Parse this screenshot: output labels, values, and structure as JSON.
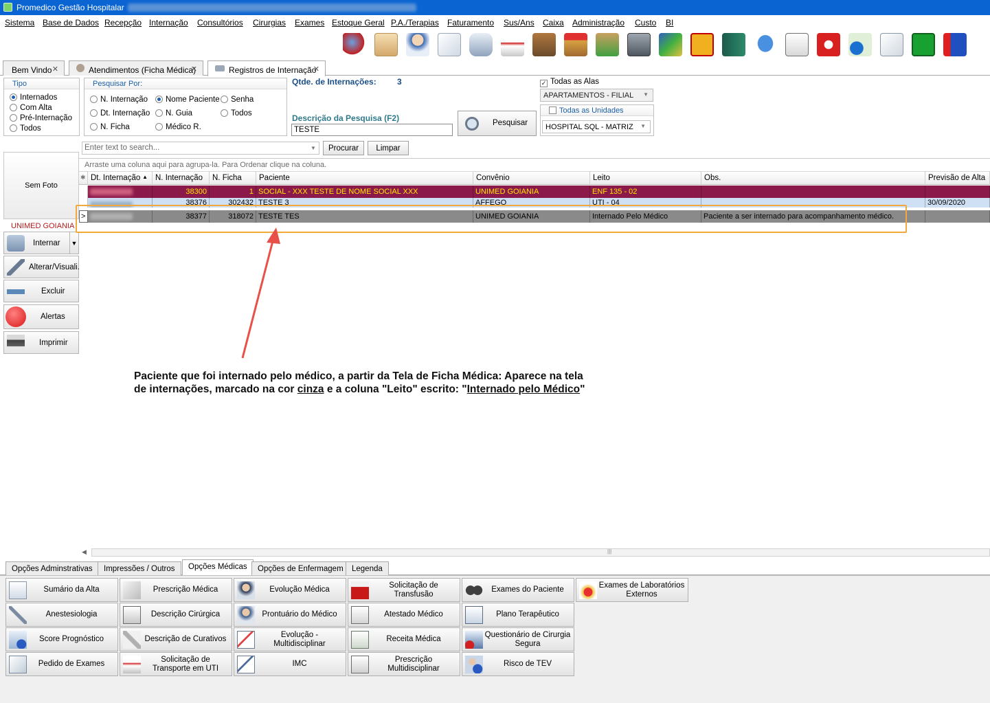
{
  "window": {
    "title": "Promedico Gestão Hospitalar"
  },
  "menu": [
    "Sistema",
    "Base de Dados",
    "Recepção",
    "Internação",
    "Consultórios",
    "Cirurgias",
    "Exames",
    "Estoque Geral",
    "P.A./Terapias",
    "Faturamento",
    "Sus/Ans",
    "Caixa",
    "Administração",
    "Custo",
    "BI"
  ],
  "toolbar_icons": [
    "agenda-icon",
    "users-icon",
    "doctor-icon",
    "document-icon",
    "car-icon",
    "ambulance-icon",
    "box-icon",
    "stock-up-icon",
    "stock-down-icon",
    "safe-icon",
    "chart-money-icon",
    "phone-icon",
    "book-icon",
    "chat-icon",
    "calculator-icon",
    "power-icon",
    "web-icon",
    "notes-icon",
    "ecg-icon",
    "contacts-icon"
  ],
  "doc_tabs": [
    {
      "label": "Bem Vindo"
    },
    {
      "label": "Atendimentos (Ficha Médica)"
    },
    {
      "label": "Registros de Internação"
    }
  ],
  "tipo": {
    "title": "Tipo",
    "options": [
      "Internados",
      "Com Alta",
      "Pré-Internação",
      "Todos"
    ],
    "selected": "Internados"
  },
  "pesquisar_por": {
    "title": "Pesquisar Por:",
    "options": [
      "N. Internação",
      "Nome Paciente",
      "Senha",
      "Dt. Internação",
      "N. Guia",
      "Todos",
      "N. Ficha",
      "Médico R."
    ],
    "selected": "Nome Paciente"
  },
  "qtde": {
    "label": "Qtde. de Internações:",
    "value": "3"
  },
  "descricao": {
    "label": "Descrição da Pesquisa (F2)",
    "value": "TESTE"
  },
  "pesquisar_button": "Pesquisar",
  "alas": {
    "checkbox_label": "Todas as Alas",
    "checked": true,
    "value": "APARTAMENTOS - FILIAL"
  },
  "unidades": {
    "checkbox_label": "Todas as Unidades",
    "checked": false,
    "value": "HOSPITAL SQL - MATRIZ"
  },
  "search": {
    "placeholder": "Enter text to search...",
    "find_button": "Procurar",
    "clear_button": "Limpar"
  },
  "photo_label": "Sem Foto",
  "convenio_label": "UNIMED GOIANIA",
  "side_actions": [
    "Internar",
    "Alterar/Visuali.",
    "Excluir",
    "Alertas",
    "Imprimir"
  ],
  "grid": {
    "grouping_hint": "Arraste uma coluna aqui para agrupa-la. Para Ordenar clique na coluna.",
    "columns": [
      "Dt. Internação",
      "N. Internação",
      "N. Ficha",
      "Paciente",
      "Convênio",
      "Leito",
      "Obs.",
      "Previsão de Alta"
    ],
    "rows": [
      {
        "n_internacao": "38300",
        "n_ficha": "1",
        "paciente": "SOCIAL - XXX TESTE DE NOME SOCIAL XXX",
        "convenio": "UNIMED GOIANIA",
        "leito": "ENF 135 - 02",
        "obs": "",
        "previsao_alta": "",
        "style": "maroon"
      },
      {
        "n_internacao": "38376",
        "n_ficha": "302432",
        "paciente": "TESTE 3",
        "convenio": "AFFEGO",
        "leito": "UTI - 04",
        "obs": "",
        "previsao_alta": "30/09/2020",
        "style": "blue"
      },
      {
        "n_internacao": "38377",
        "n_ficha": "318072",
        "paciente": "TESTE TES",
        "convenio": "UNIMED GOIANIA",
        "leito": "Internado Pelo Médico",
        "obs": "Paciente a ser internado para acompanhamento médico.",
        "previsao_alta": "",
        "style": "gray"
      }
    ]
  },
  "annotation": {
    "line1": "Paciente que foi internado pelo médico, a partir da Tela de Ficha Médica:  Aparece na tela",
    "line2_a": "de internações, marcado na cor ",
    "line2_b": "cinza",
    "line2_c": " e a coluna \"Leito\" escrito: \"",
    "line2_d": "Internado pelo Médico",
    "line2_e": "\""
  },
  "bottom_tabs": [
    "Opções Adminstrativas",
    "Impressões / Outros",
    "Opções Médicas",
    "Opções de Enfermagem",
    "Legenda"
  ],
  "bottom_active": "Opções Médicas",
  "medical_options": [
    [
      "Sumário da Alta",
      "Prescrição Médica",
      "Evolução Médica",
      "Solicitação de Transfusão",
      "Exames do Paciente",
      "Exames de Laboratórios Externos"
    ],
    [
      "Anestesiologia",
      "Descrição Cirúrgica",
      "Prontuário do Médico",
      "Atestado Médico",
      "Plano Terapêutico"
    ],
    [
      "Score Prognóstico",
      "Descrição de Curativos",
      "Evolução - Multidisciplinar",
      "Receita Médica",
      "Questionário de Cirurgia Segura"
    ],
    [
      "Pedido de Exames",
      "Solicitação de Transporte em UTI",
      "IMC",
      "Prescrição Multidisciplinar",
      "Risco de TEV"
    ]
  ],
  "colors": {
    "titlebar": "#0a64d2",
    "row_maroon": "#8b1a4a",
    "row_maroon_text": "#ffe600",
    "row_blue": "#cfe0f5",
    "row_gray": "#8a8a8a",
    "highlight": "#f2a93b",
    "arrow": "#e8504a"
  }
}
